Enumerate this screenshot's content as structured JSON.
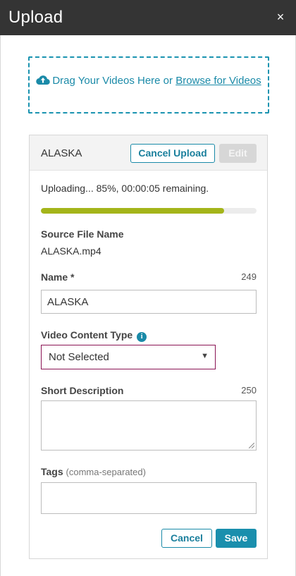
{
  "header": {
    "title": "Upload",
    "close_icon": "close-icon",
    "close_glyph": "×"
  },
  "dropzone": {
    "text": "Drag Your Videos Here or ",
    "link": "Browse for Videos",
    "icon": "cloud-upload-icon"
  },
  "upload": {
    "file_title": "ALASKA",
    "cancel_upload_label": "Cancel Upload",
    "edit_label": "Edit",
    "status": "Uploading... 85%, 00:00:05 remaining.",
    "progress": 0.85
  },
  "form": {
    "source_label": "Source File Name",
    "source_value": "ALASKA.mp4",
    "name_label": "Name",
    "name_required": "*",
    "name_counter": "249",
    "name_value": "ALASKA",
    "content_type_label": "Video Content Type",
    "info_icon": "i",
    "content_type_selected": "Not Selected",
    "short_desc_label": "Short Description",
    "short_desc_counter": "250",
    "short_desc_value": "",
    "tags_label": "Tags",
    "tags_hint": "(comma-separated)",
    "tags_value": ""
  },
  "actions": {
    "cancel_label": "Cancel",
    "save_label": "Save"
  },
  "colors": {
    "header_bg": "#343434",
    "accent": "#1a8fad",
    "progress": "#a4b51a",
    "select_border": "#8a1454"
  }
}
